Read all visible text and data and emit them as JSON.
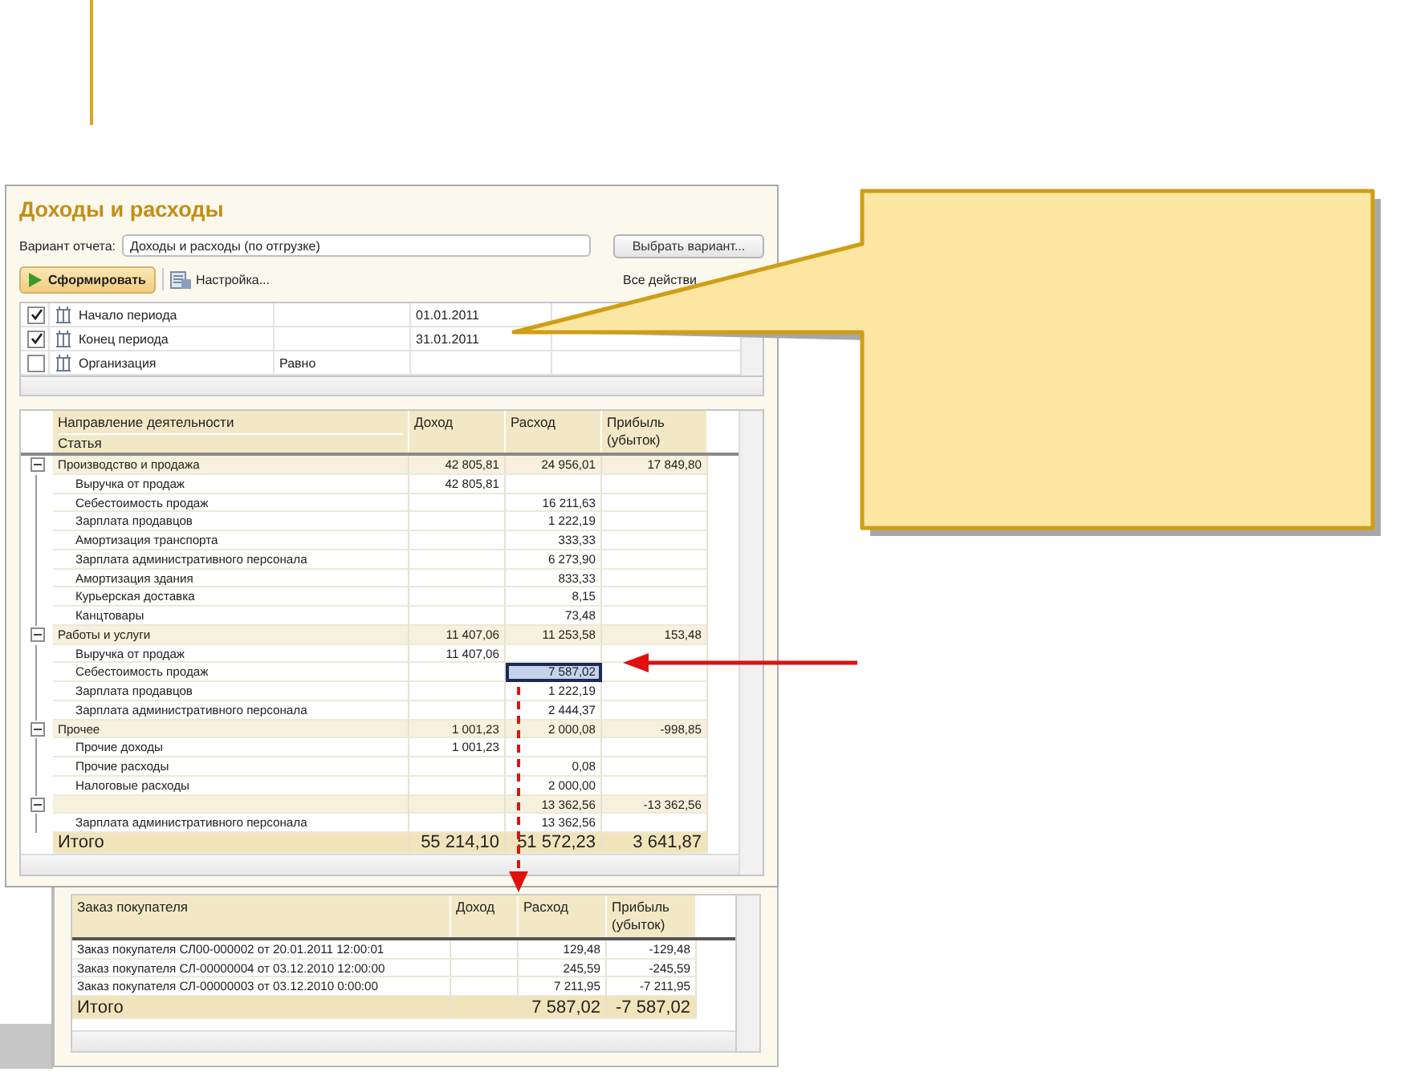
{
  "report": {
    "title": "Доходы и расходы",
    "variant_label": "Вариант отчета:",
    "variant_value": "Доходы и расходы (по отгрузке)",
    "choose_button": "Выбрать вариант...",
    "generate_button": "Сформировать",
    "settings_button": "Настройка...",
    "all_actions": "Все действи",
    "settings": [
      {
        "checked": true,
        "name": "Начало периода",
        "value": "01.01.2011"
      },
      {
        "checked": true,
        "name": "Конец периода",
        "value": "31.01.2011"
      },
      {
        "checked": false,
        "name": "Организация",
        "condition": "Равно"
      }
    ],
    "columns": {
      "direction": "Направление деятельности",
      "article": "Статья",
      "income": "Доход",
      "expense": "Расход",
      "profit": "Прибыль (убыток)"
    },
    "groups": [
      {
        "name": "Производство и продажа",
        "income": "42 805,81",
        "expense": "24 956,01",
        "profit": "17 849,80",
        "expanded": true,
        "selected": false,
        "children": [
          {
            "name": "Выручка от продаж",
            "income": "42 805,81",
            "selected": false
          },
          {
            "name": "Себестоимость продаж",
            "expense": "16 211,63",
            "selected": false
          },
          {
            "name": "Зарплата продавцов",
            "expense": "1 222,19",
            "selected": false
          },
          {
            "name": "Амортизация транспорта",
            "expense": "333,33",
            "selected": false
          },
          {
            "name": "Зарплата административного персонала",
            "expense": "6 273,90",
            "selected": false
          },
          {
            "name": "Амортизация здания",
            "expense": "833,33",
            "selected": false
          },
          {
            "name": "Курьерская доставка",
            "expense": "8,15",
            "selected": false
          },
          {
            "name": "Канцтовары",
            "expense": "73,48",
            "selected": false
          }
        ]
      },
      {
        "name": "Работы и услуги",
        "income": "11 407,06",
        "expense": "11 253,58",
        "profit": "153,48",
        "expanded": true,
        "selected": false,
        "children": [
          {
            "name": "Выручка от продаж",
            "income": "11 407,06",
            "selected": false
          },
          {
            "name": "Себестоимость продаж",
            "expense": "7 587,02",
            "selected": true
          },
          {
            "name": "Зарплата продавцов",
            "expense": "1 222,19",
            "selected": false
          },
          {
            "name": "Зарплата административного персонала",
            "expense": "2 444,37",
            "selected": false
          }
        ]
      },
      {
        "name": "Прочее",
        "income": "1 001,23",
        "expense": "2 000,08",
        "profit": "-998,85",
        "expanded": true,
        "selected": false,
        "children": [
          {
            "name": "Прочие доходы",
            "income": "1 001,23",
            "selected": false
          },
          {
            "name": "Прочие расходы",
            "expense": "0,08",
            "selected": false
          },
          {
            "name": "Налоговые расходы",
            "expense": "2 000,00",
            "selected": false
          }
        ]
      },
      {
        "expense": "13 362,56",
        "profit": "-13 362,56",
        "expanded": true,
        "selected": false,
        "children": [
          {
            "name": "Зарплата административного персонала",
            "expense": "13 362,56",
            "selected": false
          }
        ]
      }
    ],
    "total": {
      "label": "Итого",
      "income": "55 214,10",
      "expense": "51 572,23",
      "profit": "3 641,87"
    }
  },
  "detail": {
    "columns": {
      "order": "Заказ покупателя",
      "income": "Доход",
      "expense": "Расход",
      "profit": "Прибыль (убыток)"
    },
    "rows": [
      {
        "order": "Заказ покупателя СЛ00-000002 от 20.01.2011 12:00:01",
        "expense": "129,48",
        "profit": "-129,48"
      },
      {
        "order": "Заказ покупателя СЛ-00000004 от 03.12.2010 12:00:00",
        "expense": "245,59",
        "profit": "-245,59"
      },
      {
        "order": "Заказ покупателя СЛ-00000003 от 03.12.2010 0:00:00",
        "expense": "7 211,95",
        "profit": "-7 211,95"
      }
    ],
    "total": {
      "label": "Итого",
      "expense": "7 587,02",
      "profit": "-7 587,02"
    }
  }
}
